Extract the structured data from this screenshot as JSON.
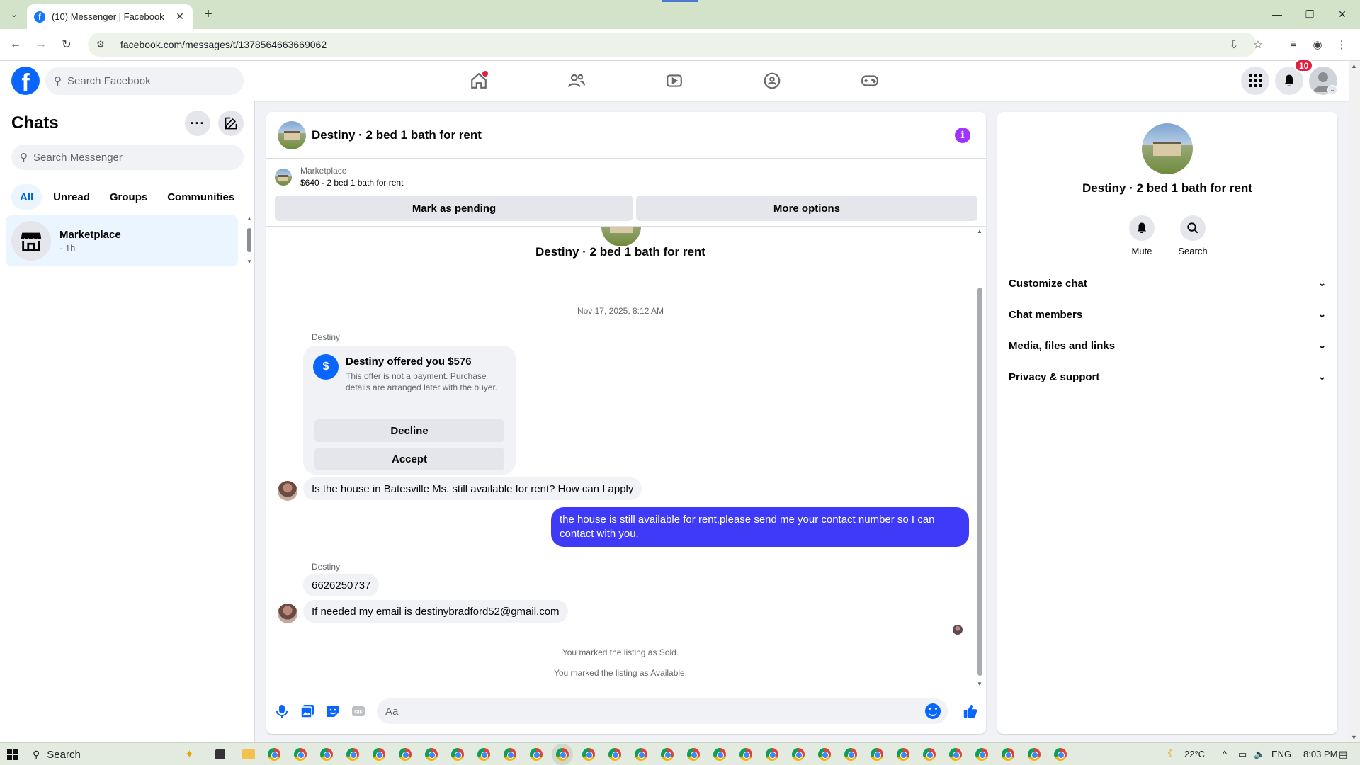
{
  "browser": {
    "tab_title": "(10) Messenger | Facebook",
    "url": "facebook.com/messages/t/1378564663669062"
  },
  "fb": {
    "search_placeholder": "Search Facebook",
    "notification_count": "10"
  },
  "chats": {
    "heading": "Chats",
    "search_placeholder": "Search Messenger",
    "filters": [
      "All",
      "Unread",
      "Groups",
      "Communities"
    ],
    "active_filter": "All",
    "items": [
      {
        "name": "Marketplace",
        "time": "· 1h"
      }
    ]
  },
  "conversation": {
    "title": "Destiny · 2 bed 1 bath for rent",
    "listing": {
      "label": "Marketplace",
      "price_title": "$640 - 2 bed 1 bath for rent",
      "mark_pending": "Mark as pending",
      "more_options": "More options"
    },
    "top_name": "Destiny · 2 bed 1 bath for rent",
    "timestamp": "Nov 17, 2025, 8:12 AM",
    "offer": {
      "sender": "Destiny",
      "title": "Destiny offered you $576",
      "description": "This offer is not a payment. Purchase details are arranged later with the buyer.",
      "decline": "Decline",
      "accept": "Accept"
    },
    "messages": [
      {
        "from": "Destiny",
        "text": "Is the house in Batesville Ms. still available for rent? How can I apply"
      },
      {
        "from": "me",
        "text": "the house is still available for rent,please send me your contact number so I can contact with you."
      },
      {
        "from": "Destiny",
        "sender_label": "Destiny",
        "text": "6626250737"
      },
      {
        "from": "Destiny",
        "text": "If needed my email is destinybradford52@gmail.com"
      }
    ],
    "system_notes": [
      "You marked the listing as Sold.",
      "You marked the listing as Available."
    ],
    "composer_placeholder": "Aa"
  },
  "info_panel": {
    "name": "Destiny · 2 bed 1 bath for rent",
    "actions": [
      "Mute",
      "Search"
    ],
    "sections": [
      "Customize chat",
      "Chat members",
      "Media, files and links",
      "Privacy & support"
    ]
  },
  "taskbar": {
    "search_label": "Search",
    "temperature": "22°C",
    "language": "ENG",
    "time": "8:03 PM"
  },
  "colors": {
    "accent": "#0866ff",
    "outgoing_bubble": "#3e3af7",
    "info_icon": "#a033ff",
    "badge": "#e41e3f"
  }
}
